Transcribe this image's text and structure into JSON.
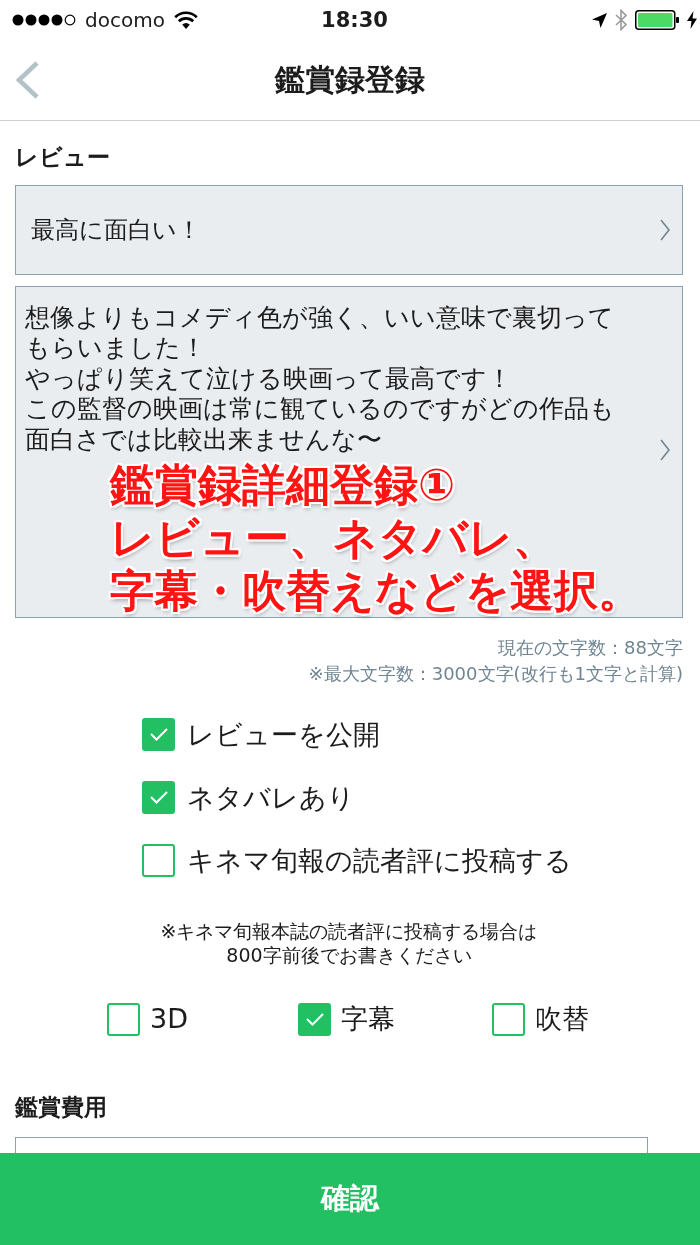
{
  "status_bar": {
    "carrier": "docomo",
    "time": "18:30"
  },
  "nav_bar": {
    "title": "鑑賞録登録"
  },
  "review": {
    "label": "レビュー",
    "summary": "最高に面白い！",
    "body_lines": [
      "想像よりもコメディ色が強く、いい意味で裏切って",
      "もらいました！",
      "やっぱり笑えて泣ける映画って最高です！",
      "この監督の映画は常に観ているのですがどの作品も",
      "面白さでは比較出来ませんな〜"
    ],
    "char_count": "現在の文字数：88文字",
    "char_limit": "※最大文字数：3000文字(改行も1文字と計算)"
  },
  "options": [
    {
      "label": "レビューを公開",
      "checked": true
    },
    {
      "label": "ネタバレあり",
      "checked": true
    },
    {
      "label": "キネマ旬報の読者評に投稿する",
      "checked": false
    }
  ],
  "note_lines": [
    "※キネマ旬報本誌の読者評に投稿する場合は",
    "800字前後でお書きください"
  ],
  "formats": [
    {
      "label": "3D",
      "checked": false
    },
    {
      "label": "字幕",
      "checked": true
    },
    {
      "label": "吹替",
      "checked": false
    }
  ],
  "cost": {
    "label": "鑑賞費用"
  },
  "callout": {
    "title": "鑑賞録詳細登録①",
    "lines": [
      "レビュー、ネタバレ、",
      "字幕・吹替えなどを選択。"
    ]
  },
  "confirm_button": "確認"
}
